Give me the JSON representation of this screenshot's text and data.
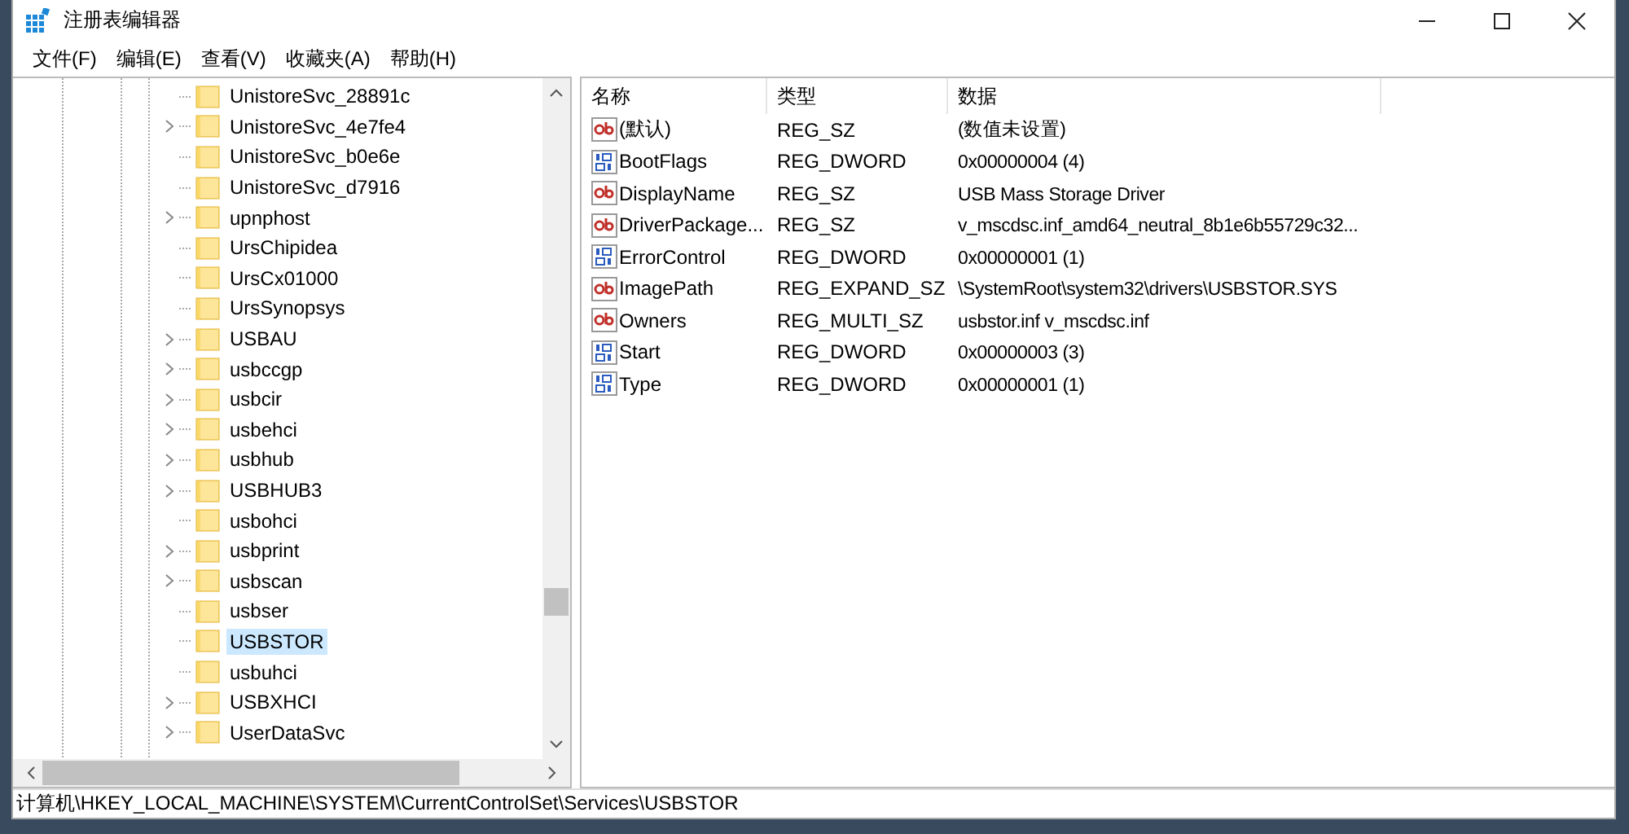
{
  "window": {
    "title": "注册表编辑器"
  },
  "menu": [
    "文件(F)",
    "编辑(E)",
    "查看(V)",
    "收藏夹(A)",
    "帮助(H)"
  ],
  "tree": [
    {
      "label": "UnistoreSvc_28891c",
      "expandable": false,
      "selected": false
    },
    {
      "label": "UnistoreSvc_4e7fe4",
      "expandable": true,
      "selected": false
    },
    {
      "label": "UnistoreSvc_b0e6e",
      "expandable": false,
      "selected": false
    },
    {
      "label": "UnistoreSvc_d7916",
      "expandable": false,
      "selected": false
    },
    {
      "label": "upnphost",
      "expandable": true,
      "selected": false
    },
    {
      "label": "UrsChipidea",
      "expandable": false,
      "selected": false
    },
    {
      "label": "UrsCx01000",
      "expandable": false,
      "selected": false
    },
    {
      "label": "UrsSynopsys",
      "expandable": false,
      "selected": false
    },
    {
      "label": "USBAU",
      "expandable": true,
      "selected": false
    },
    {
      "label": "usbccgp",
      "expandable": true,
      "selected": false
    },
    {
      "label": "usbcir",
      "expandable": true,
      "selected": false
    },
    {
      "label": "usbehci",
      "expandable": true,
      "selected": false
    },
    {
      "label": "usbhub",
      "expandable": true,
      "selected": false
    },
    {
      "label": "USBHUB3",
      "expandable": true,
      "selected": false
    },
    {
      "label": "usbohci",
      "expandable": false,
      "selected": false
    },
    {
      "label": "usbprint",
      "expandable": true,
      "selected": false
    },
    {
      "label": "usbscan",
      "expandable": true,
      "selected": false
    },
    {
      "label": "usbser",
      "expandable": false,
      "selected": false
    },
    {
      "label": "USBSTOR",
      "expandable": false,
      "selected": true
    },
    {
      "label": "usbuhci",
      "expandable": false,
      "selected": false
    },
    {
      "label": "USBXHCI",
      "expandable": true,
      "selected": false
    },
    {
      "label": "UserDataSvc",
      "expandable": true,
      "selected": false
    }
  ],
  "values": {
    "columns": [
      "名称",
      "类型",
      "数据"
    ],
    "rows": [
      {
        "kind": "string",
        "name": "(默认)",
        "type": "REG_SZ",
        "data": "(数值未设置)"
      },
      {
        "kind": "binary",
        "name": "BootFlags",
        "type": "REG_DWORD",
        "data": "0x00000004 (4)"
      },
      {
        "kind": "string",
        "name": "DisplayName",
        "type": "REG_SZ",
        "data": "USB Mass Storage Driver"
      },
      {
        "kind": "string",
        "name": "DriverPackage...",
        "type": "REG_SZ",
        "data": "v_mscdsc.inf_amd64_neutral_8b1e6b55729c32..."
      },
      {
        "kind": "binary",
        "name": "ErrorControl",
        "type": "REG_DWORD",
        "data": "0x00000001 (1)"
      },
      {
        "kind": "string",
        "name": "ImagePath",
        "type": "REG_EXPAND_SZ",
        "data": "\\SystemRoot\\system32\\drivers\\USBSTOR.SYS"
      },
      {
        "kind": "string",
        "name": "Owners",
        "type": "REG_MULTI_SZ",
        "data": "usbstor.inf v_mscdsc.inf"
      },
      {
        "kind": "binary",
        "name": "Start",
        "type": "REG_DWORD",
        "data": "0x00000003 (3)"
      },
      {
        "kind": "binary",
        "name": "Type",
        "type": "REG_DWORD",
        "data": "0x00000001 (1)"
      }
    ]
  },
  "status_bar": "计算机\\HKEY_LOCAL_MACHINE\\SYSTEM\\CurrentControlSet\\Services\\USBSTOR"
}
